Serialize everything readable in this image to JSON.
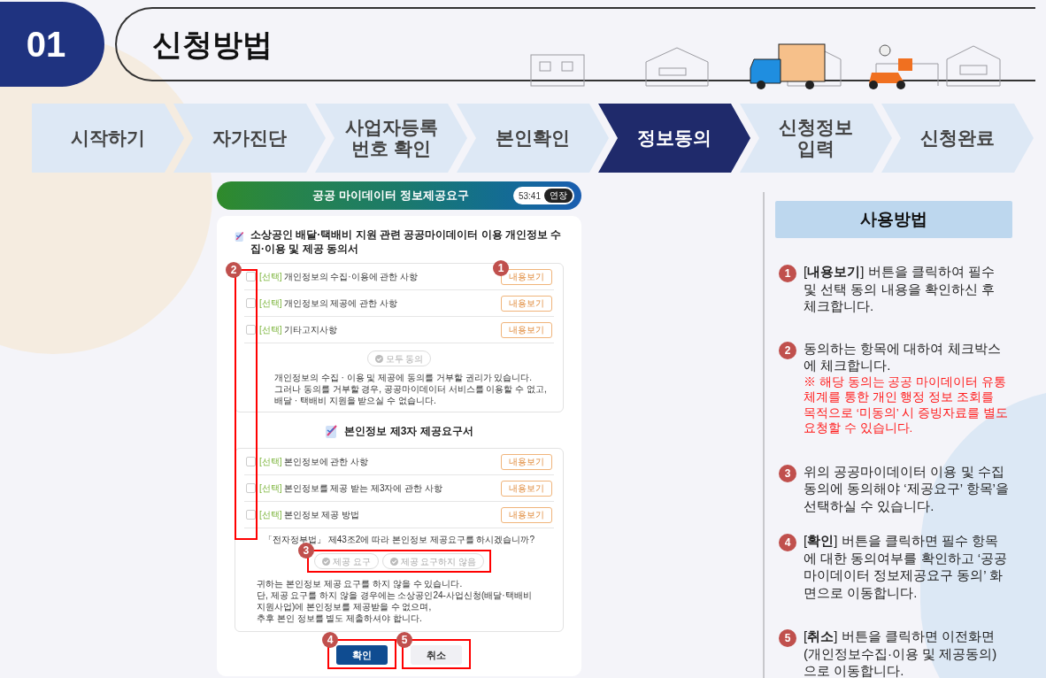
{
  "header": {
    "number": "01",
    "title": "신청방법"
  },
  "steps": [
    {
      "label": "시작하기",
      "selected": false
    },
    {
      "label": "자가진단",
      "selected": false
    },
    {
      "label": "사업자등록\n번호 확인",
      "selected": false
    },
    {
      "label": "본인확인",
      "selected": false
    },
    {
      "label": "정보동의",
      "selected": true
    },
    {
      "label": "신청정보\n입력",
      "selected": false
    },
    {
      "label": "신청완료",
      "selected": false
    }
  ],
  "phone": {
    "title": "공공 마이데이터 정보제공요구",
    "timer": "53:41",
    "extend_button": "연장",
    "consent": {
      "title": "소상공인 배달·택배비 지원 관련 공공마이데이터 이용 개인정보 수집·이용 및 제공 동의서",
      "items": [
        {
          "tag": "[선택]",
          "label": "개인정보의 수집·이용에 관한 사항",
          "checked": false,
          "button": "내용보기"
        },
        {
          "tag": "[선택]",
          "label": "개인정보의 제공에 관한 사항",
          "checked": false,
          "button": "내용보기"
        },
        {
          "tag": "[선택]",
          "label": "기타고지사항",
          "checked": false,
          "button": "내용보기"
        }
      ],
      "agree_all": "모두 동의",
      "notice": [
        "개인정보의 수집 · 이용 및 제공에 동의를 거부할 권리가 있습니다.",
        "그러나 동의를 거부할 경우, 공공마이데이터 서비스를 이용할 수 없고, 배달 · 택배비 지원을 받으실 수 없습니다."
      ]
    },
    "provision": {
      "title": "본인정보 제3자 제공요구서",
      "items": [
        {
          "tag": "[선택]",
          "label": "본인정보에 관한 사항",
          "checked": false,
          "button": "내용보기"
        },
        {
          "tag": "[선택]",
          "label": "본인정보를 제공 받는 제3자에 관한 사항",
          "checked": false,
          "button": "내용보기"
        },
        {
          "tag": "[선택]",
          "label": "본인정보 제공 방법",
          "checked": false,
          "button": "내용보기"
        }
      ],
      "question": "「전자정부법」 제43조2에 따라 본인정보 제공요구를 하시겠습니까?",
      "options": [
        {
          "label": "제공 요구",
          "selected": false
        },
        {
          "label": "제공 요구하지 않음",
          "selected": false
        }
      ],
      "notice": [
        "귀하는 본인정보 제공 요구를 하지 않을 수 있습니다.",
        "단, 제공 요구를 하지 않을 경우에는 소상공인24-사업신청(배달·택배비 지원사업)에 본인정보를 제공받을 수 없으며,",
        "추후 본인 정보를 별도 제출하셔야 합니다."
      ]
    },
    "buttons": [
      {
        "label": "확인",
        "kind": "primary"
      },
      {
        "label": "취소",
        "kind": "secondary"
      }
    ],
    "markers": [
      "1",
      "2",
      "3",
      "4",
      "5"
    ]
  },
  "guide": {
    "title": "사용방법",
    "steps": [
      {
        "number": "1",
        "text": "[**내용보기**] 버튼을 클릭하여 필수 및 선택 동의 내용을 확인하신 후 체크합니다."
      },
      {
        "number": "2",
        "text": "동의하는 항목에 대하여 체크박스에 체크합니다.",
        "note": "※ 해당 동의는 공공 마이데이터 유통체계를 통한 개인 행정 정보 조회를 목적으로 ‘미동의’ 시 증빙자료를 별도 요청할 수 있습니다."
      },
      {
        "number": "3",
        "text": "위의 공공마이데이터 이용 및 수집 동의에 동의해야 ‘제공요구’ 항목’을 선택하실 수 있습니다."
      },
      {
        "number": "4",
        "text": "[**확인**] 버튼을 클릭하면 필수 항목에 대한 동의여부를 확인하고 ‘공공 마이데이터 정보제공요구 동의’ 화면으로 이동합니다."
      },
      {
        "number": "5",
        "text": "[**취소**] 버튼을 클릭하면 이전화면(개인정보수집·이용 및 제공동의)으로 이동합니다."
      }
    ]
  }
}
